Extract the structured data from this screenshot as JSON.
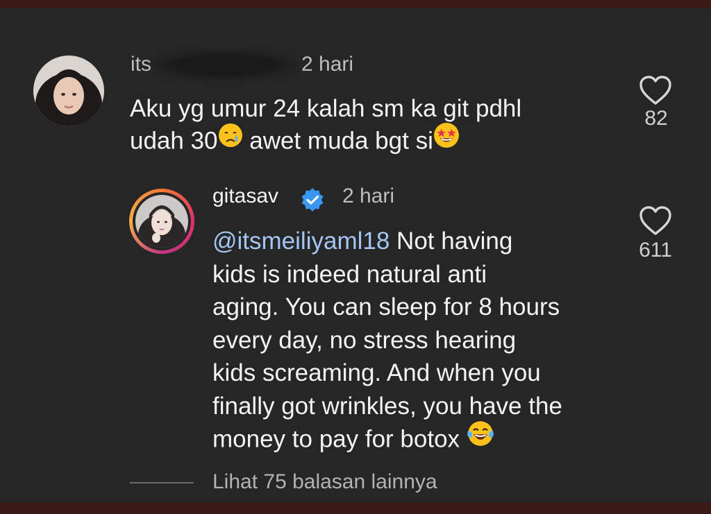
{
  "comment": {
    "username": "its",
    "time": "2 hari",
    "text_line1": "Aku yg umur 24 kalah sm ka git pdhl",
    "text_line2a": "udah 30",
    "emoji1": "crying-face",
    "text_line2b": " awet muda bgt si",
    "emoji2": "star-struck-face",
    "likes": "82"
  },
  "reply": {
    "username": "gitasav",
    "verified": true,
    "time": "2 hari",
    "mention": "@itsmeiliyaml18",
    "line1_rest": " Not having",
    "line2": "kids is indeed natural anti",
    "line3": "aging. You can sleep for 8 hours",
    "line4": "every day, no stress hearing",
    "line5": "kids screaming. And when you",
    "line6": "finally got wrinkles, you have the",
    "line7": "money to pay for botox ",
    "emoji": "tears-of-joy-face",
    "likes": "611"
  },
  "view_replies": "Lihat 75 balasan lainnya",
  "colors": {
    "background": "#262626",
    "mention": "#a5c6f5",
    "verified": "#3897f0"
  }
}
